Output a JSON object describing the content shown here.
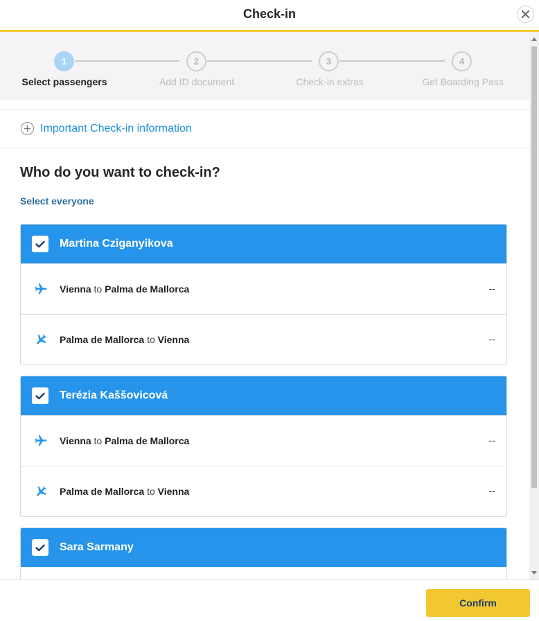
{
  "header": {
    "title": "Check-in",
    "close_icon": "close-icon"
  },
  "stepper": {
    "steps": [
      {
        "number": "1",
        "label": "Select passengers",
        "active": true
      },
      {
        "number": "2",
        "label": "Add ID document",
        "active": false
      },
      {
        "number": "3",
        "label": "Check-in extras",
        "active": false
      },
      {
        "number": "4",
        "label": "Get Boarding Pass",
        "active": false
      }
    ]
  },
  "info": {
    "label": "Important Check-in information",
    "icon": "plus-circle-icon"
  },
  "main": {
    "question": "Who do you want to check-in?",
    "select_all": "Select everyone"
  },
  "passengers": [
    {
      "name": "Martina Cziganyikova",
      "checked": true,
      "legs": [
        {
          "from": "Vienna",
          "connector": "to",
          "to": "Palma de Mallorca",
          "status": "--",
          "icon": "plane-departure-icon"
        },
        {
          "from": "Palma de Mallorca",
          "connector": "to",
          "to": "Vienna",
          "status": "--",
          "icon": "plane-return-icon"
        }
      ]
    },
    {
      "name": "Terézia Kaššovicová",
      "checked": true,
      "legs": [
        {
          "from": "Vienna",
          "connector": "to",
          "to": "Palma de Mallorca",
          "status": "--",
          "icon": "plane-departure-icon"
        },
        {
          "from": "Palma de Mallorca",
          "connector": "to",
          "to": "Vienna",
          "status": "--",
          "icon": "plane-return-icon"
        }
      ]
    },
    {
      "name": "Sara Sarmany",
      "checked": true,
      "legs": []
    }
  ],
  "footer": {
    "confirm_label": "Confirm"
  },
  "colors": {
    "accent_yellow": "#f2c832",
    "card_blue": "#2594ea",
    "link_blue": "#1f8fd6"
  }
}
